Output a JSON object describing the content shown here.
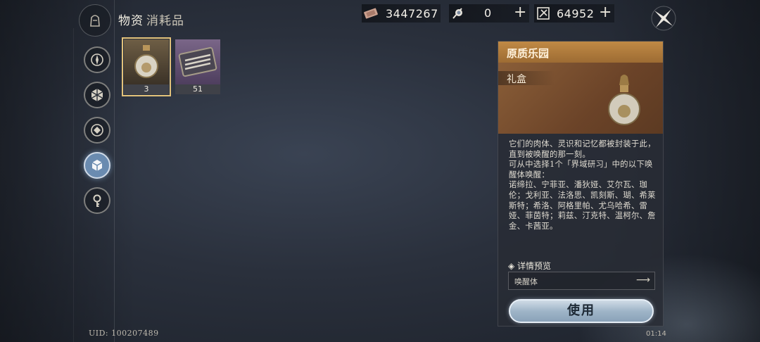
{
  "header": {
    "title": "物资",
    "subtitle": "消耗品"
  },
  "currencies": [
    {
      "icon": "ticket-icon",
      "value": "3447267"
    },
    {
      "icon": "scroll-icon",
      "value": "0",
      "plus": "+"
    },
    {
      "icon": "crystal-card-icon",
      "value": "64952",
      "plus": "+"
    }
  ],
  "nav": [
    {
      "icon": "compass-icon"
    },
    {
      "icon": "hexagon-icon"
    },
    {
      "icon": "diamond-target-icon"
    },
    {
      "icon": "cube-icon",
      "active": true
    },
    {
      "icon": "key-icon"
    }
  ],
  "items": [
    {
      "name": "bottle-gift",
      "count": "3",
      "selected": true
    },
    {
      "name": "tool-case",
      "count": "51"
    }
  ],
  "detail": {
    "name": "原质乐园",
    "type": "礼盒",
    "description": "它们的肉体、灵识和记忆都被封装于此，直到被唤醒的那一刻。\n可从中选择1个「界域研习」中的以下唤醒体唤醒：\n诺缔拉、宁菲亚、潘狄娅、艾尔瓦、珈伦；戈利亚、法洛思、凯刻斯、瑚、希莱斯特；希洛、阿格里帕、尤乌哈希、雷娅、菲茵特；莉兹、汀克特、温柯尔、詹金、卡茜亚。",
    "detail_label": "◈ 详情预览",
    "detail_field": "唤醒体",
    "use_label": "使用"
  },
  "footer": {
    "uid": "UID: 100207489",
    "time": "01:14"
  },
  "colors": {
    "accent_gold": "#e3c27a",
    "header_orange": "#c08a45",
    "active_blue": "#6a8bb0"
  }
}
